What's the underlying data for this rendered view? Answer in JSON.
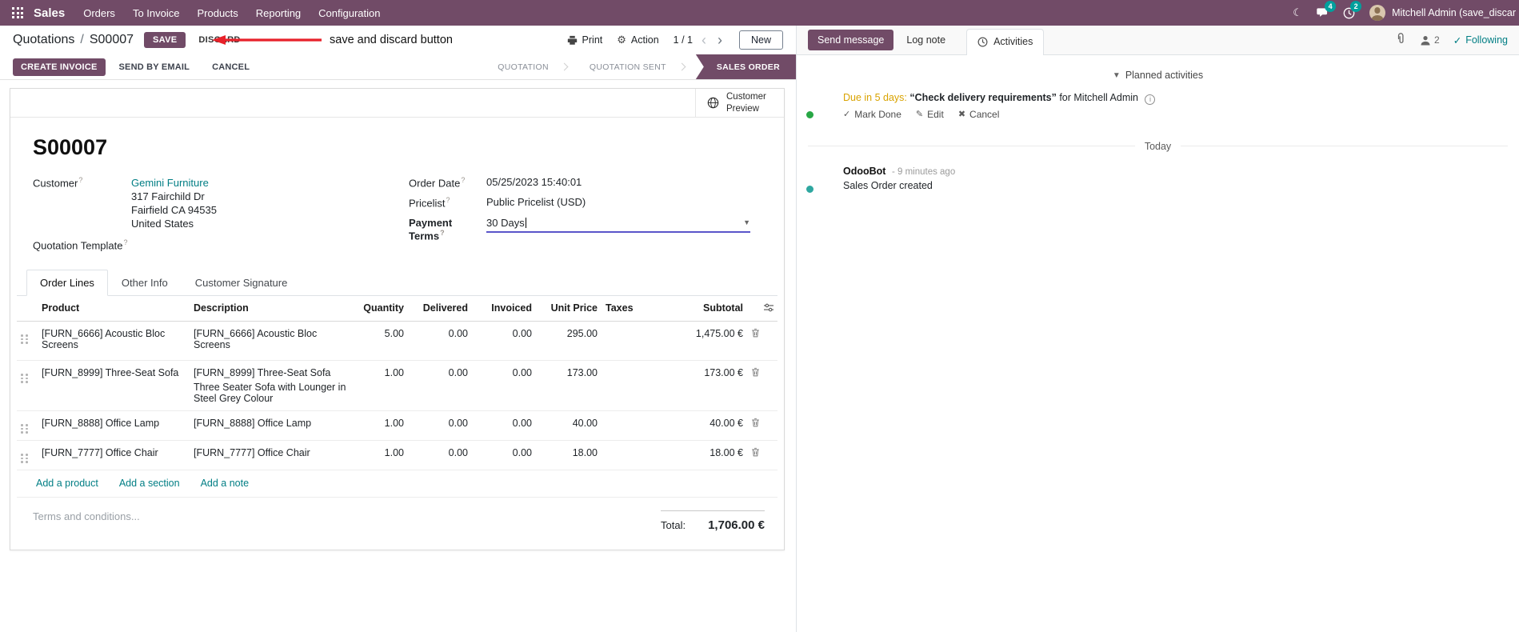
{
  "colors": {
    "primary": "#714B67",
    "link": "#017E84",
    "warning": "#D9A300",
    "annotation_red": "#E8212A",
    "badge": "#00A09D"
  },
  "navbar": {
    "app_name": "Sales",
    "menus": [
      "Orders",
      "To Invoice",
      "Products",
      "Reporting",
      "Configuration"
    ],
    "messages_badge": "4",
    "activities_badge": "2",
    "user_name": "Mitchell Admin (save_discar"
  },
  "control_panel": {
    "breadcrumb_parent": "Quotations",
    "breadcrumb_sep": "/",
    "breadcrumb_current": "S00007",
    "save_label": "SAVE",
    "discard_label": "DISCARD",
    "annotation_text": "save and discard button",
    "print_label": "Print",
    "action_label": "Action",
    "pager": "1 / 1",
    "new_label": "New"
  },
  "statusbar": {
    "create_invoice": "CREATE INVOICE",
    "send_by_email": "SEND BY EMAIL",
    "cancel": "CANCEL",
    "stages": [
      "QUOTATION",
      "QUOTATION SENT",
      "SALES ORDER"
    ],
    "active_stage": "SALES ORDER"
  },
  "sheet": {
    "customer_preview": "Customer Preview",
    "record_name": "S00007",
    "hint": "?",
    "customer_label": "Customer",
    "customer_name": "Gemini Furniture",
    "address_line1": "317 Fairchild Dr",
    "address_line2": "Fairfield CA 94535",
    "address_line3": "United States",
    "quotation_template_label": "Quotation Template",
    "order_date_label": "Order Date",
    "order_date": "05/25/2023 15:40:01",
    "pricelist_label": "Pricelist",
    "pricelist": "Public Pricelist (USD)",
    "payment_terms_label": "Payment Terms",
    "payment_terms": "30 Days",
    "tabs": [
      "Order Lines",
      "Other Info",
      "Customer Signature"
    ],
    "table": {
      "headers": {
        "product": "Product",
        "description": "Description",
        "quantity": "Quantity",
        "delivered": "Delivered",
        "invoiced": "Invoiced",
        "unit_price": "Unit Price",
        "taxes": "Taxes",
        "subtotal": "Subtotal"
      },
      "rows": [
        {
          "product": "[FURN_6666] Acoustic Bloc Screens",
          "desc": "[FURN_6666] Acoustic Bloc Screens",
          "qty": "5.00",
          "delivered": "0.00",
          "invoiced": "0.00",
          "unit_price": "295.00",
          "taxes": "",
          "subtotal": "1,475.00 €"
        },
        {
          "product": "[FURN_8999] Three-Seat Sofa",
          "desc": "[FURN_8999] Three-Seat Sofa",
          "desc2": "Three Seater Sofa with Lounger in Steel Grey Colour",
          "qty": "1.00",
          "delivered": "0.00",
          "invoiced": "0.00",
          "unit_price": "173.00",
          "taxes": "",
          "subtotal": "173.00 €"
        },
        {
          "product": "[FURN_8888] Office Lamp",
          "desc": "[FURN_8888] Office Lamp",
          "qty": "1.00",
          "delivered": "0.00",
          "invoiced": "0.00",
          "unit_price": "40.00",
          "taxes": "",
          "subtotal": "40.00 €"
        },
        {
          "product": "[FURN_7777] Office Chair",
          "desc": "[FURN_7777] Office Chair",
          "qty": "1.00",
          "delivered": "0.00",
          "invoiced": "0.00",
          "unit_price": "18.00",
          "taxes": "",
          "subtotal": "18.00 €"
        }
      ]
    },
    "add_product": "Add a product",
    "add_section": "Add a section",
    "add_note": "Add a note",
    "terms_placeholder": "Terms and conditions...",
    "total_label": "Total:",
    "total_value": "1,706.00 €"
  },
  "chatter": {
    "send_message": "Send message",
    "log_note": "Log note",
    "activities_tab": "Activities",
    "followers_count": "2",
    "following": "Following",
    "planned_header": "Planned activities",
    "activity": {
      "due": "Due in 5 days:",
      "summary": "“Check delivery requirements”",
      "assignee": "for Mitchell Admin",
      "mark_done": "Mark Done",
      "edit": "Edit",
      "cancel": "Cancel"
    },
    "today": "Today",
    "message": {
      "author": "OdooBot",
      "time": "- 9 minutes ago",
      "body": "Sales Order created"
    }
  }
}
